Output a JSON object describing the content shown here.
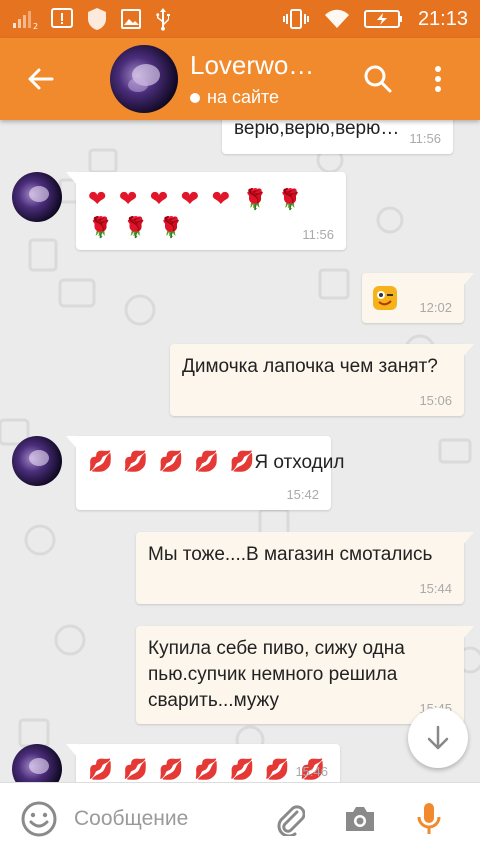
{
  "colors": {
    "status_bar": "#e6731f",
    "app_bar": "#f08a2c",
    "accent": "#f08a2c",
    "chat_bg": "#ebebeb",
    "bubble_in": "#ffffff",
    "bubble_out": "#fdf6ec"
  },
  "status_bar": {
    "time": "21:13",
    "icons": [
      "signal-icon",
      "alert-icon",
      "shield-icon",
      "image-icon",
      "usb-icon",
      "vibrate-icon",
      "wifi-icon",
      "battery-icon"
    ]
  },
  "header": {
    "contact_name": "Loverwom…",
    "status": "на сайте",
    "icons": [
      "back-arrow-icon",
      "search-icon",
      "more-vert-icon"
    ]
  },
  "messages": [
    {
      "direction": "in",
      "text": "верю,верю,верю…",
      "time": "11:56"
    },
    {
      "direction": "in",
      "emoji": [
        "❤",
        "❤",
        "❤",
        "❤",
        "❤",
        "🌹",
        "🌹",
        "🌹",
        "🌹",
        "🌹"
      ],
      "time": "11:56"
    },
    {
      "direction": "out",
      "sticker": "wink-smiley",
      "time": "12:02"
    },
    {
      "direction": "out",
      "text": "Димочка лапочка чем занят?",
      "time": "15:06"
    },
    {
      "direction": "in",
      "emoji": [
        "💋",
        "💋",
        "💋",
        "💋",
        "💋"
      ],
      "text": "Я отходил",
      "time": "15:42"
    },
    {
      "direction": "out",
      "text": "Мы тоже....В магазин смотались",
      "time": "15:44"
    },
    {
      "direction": "out",
      "lines": [
        "Купила себе пиво, сижу одна",
        "пью.супчик немного решила",
        "сварить...мужу"
      ],
      "time": "15:45"
    },
    {
      "direction": "in",
      "emoji": [
        "💋",
        "💋",
        "💋",
        "💋",
        "💋",
        "💋",
        "💋"
      ],
      "time": "15:46"
    }
  ],
  "composer": {
    "placeholder": "Сообщение",
    "icons": [
      "smile-icon",
      "paperclip-icon",
      "camera-icon",
      "mic-icon"
    ]
  },
  "scroll_down_icon": "arrow-down-icon"
}
